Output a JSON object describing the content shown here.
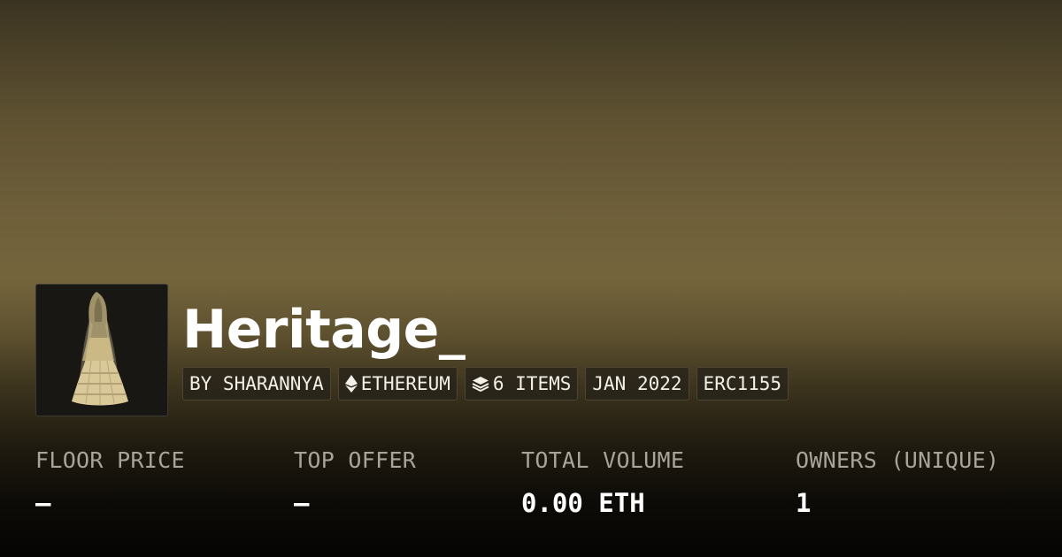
{
  "collection": {
    "name": "Heritage_",
    "image_alt": "garment artwork thumbnail"
  },
  "chips": {
    "creator": "BY SHARANNYA",
    "chain": "ETHEREUM",
    "items": "6 ITEMS",
    "date": "JAN 2022",
    "standard": "ERC1155"
  },
  "icons": {
    "chain": "ethereum-icon",
    "items": "layers-icon"
  },
  "stats": {
    "floor_price": {
      "label": "FLOOR PRICE",
      "value": "–"
    },
    "top_offer": {
      "label": "TOP OFFER",
      "value": "–"
    },
    "total_volume": {
      "label": "TOTAL VOLUME",
      "value": "0.00 ETH"
    },
    "owners": {
      "label": "OWNERS (UNIQUE)",
      "value": "1"
    }
  },
  "colors": {
    "background_top": "#3a3321",
    "background_mid": "#74653c",
    "background_bottom": "#050403",
    "label_gray": "#a8a49a",
    "chip_bg": "#262218"
  }
}
